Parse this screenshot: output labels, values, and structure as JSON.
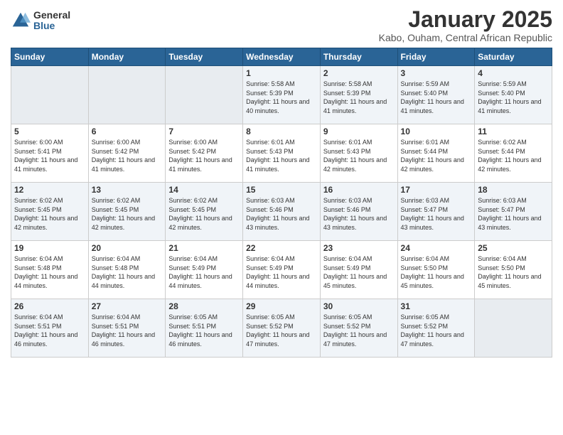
{
  "logo": {
    "general": "General",
    "blue": "Blue"
  },
  "title": "January 2025",
  "subtitle": "Kabo, Ouham, Central African Republic",
  "weekdays": [
    "Sunday",
    "Monday",
    "Tuesday",
    "Wednesday",
    "Thursday",
    "Friday",
    "Saturday"
  ],
  "weeks": [
    [
      {
        "day": "",
        "sunrise": "",
        "sunset": "",
        "daylight": ""
      },
      {
        "day": "",
        "sunrise": "",
        "sunset": "",
        "daylight": ""
      },
      {
        "day": "",
        "sunrise": "",
        "sunset": "",
        "daylight": ""
      },
      {
        "day": "1",
        "sunrise": "Sunrise: 5:58 AM",
        "sunset": "Sunset: 5:39 PM",
        "daylight": "Daylight: 11 hours and 40 minutes."
      },
      {
        "day": "2",
        "sunrise": "Sunrise: 5:58 AM",
        "sunset": "Sunset: 5:39 PM",
        "daylight": "Daylight: 11 hours and 41 minutes."
      },
      {
        "day": "3",
        "sunrise": "Sunrise: 5:59 AM",
        "sunset": "Sunset: 5:40 PM",
        "daylight": "Daylight: 11 hours and 41 minutes."
      },
      {
        "day": "4",
        "sunrise": "Sunrise: 5:59 AM",
        "sunset": "Sunset: 5:40 PM",
        "daylight": "Daylight: 11 hours and 41 minutes."
      }
    ],
    [
      {
        "day": "5",
        "sunrise": "Sunrise: 6:00 AM",
        "sunset": "Sunset: 5:41 PM",
        "daylight": "Daylight: 11 hours and 41 minutes."
      },
      {
        "day": "6",
        "sunrise": "Sunrise: 6:00 AM",
        "sunset": "Sunset: 5:42 PM",
        "daylight": "Daylight: 11 hours and 41 minutes."
      },
      {
        "day": "7",
        "sunrise": "Sunrise: 6:00 AM",
        "sunset": "Sunset: 5:42 PM",
        "daylight": "Daylight: 11 hours and 41 minutes."
      },
      {
        "day": "8",
        "sunrise": "Sunrise: 6:01 AM",
        "sunset": "Sunset: 5:43 PM",
        "daylight": "Daylight: 11 hours and 41 minutes."
      },
      {
        "day": "9",
        "sunrise": "Sunrise: 6:01 AM",
        "sunset": "Sunset: 5:43 PM",
        "daylight": "Daylight: 11 hours and 42 minutes."
      },
      {
        "day": "10",
        "sunrise": "Sunrise: 6:01 AM",
        "sunset": "Sunset: 5:44 PM",
        "daylight": "Daylight: 11 hours and 42 minutes."
      },
      {
        "day": "11",
        "sunrise": "Sunrise: 6:02 AM",
        "sunset": "Sunset: 5:44 PM",
        "daylight": "Daylight: 11 hours and 42 minutes."
      }
    ],
    [
      {
        "day": "12",
        "sunrise": "Sunrise: 6:02 AM",
        "sunset": "Sunset: 5:45 PM",
        "daylight": "Daylight: 11 hours and 42 minutes."
      },
      {
        "day": "13",
        "sunrise": "Sunrise: 6:02 AM",
        "sunset": "Sunset: 5:45 PM",
        "daylight": "Daylight: 11 hours and 42 minutes."
      },
      {
        "day": "14",
        "sunrise": "Sunrise: 6:02 AM",
        "sunset": "Sunset: 5:45 PM",
        "daylight": "Daylight: 11 hours and 42 minutes."
      },
      {
        "day": "15",
        "sunrise": "Sunrise: 6:03 AM",
        "sunset": "Sunset: 5:46 PM",
        "daylight": "Daylight: 11 hours and 43 minutes."
      },
      {
        "day": "16",
        "sunrise": "Sunrise: 6:03 AM",
        "sunset": "Sunset: 5:46 PM",
        "daylight": "Daylight: 11 hours and 43 minutes."
      },
      {
        "day": "17",
        "sunrise": "Sunrise: 6:03 AM",
        "sunset": "Sunset: 5:47 PM",
        "daylight": "Daylight: 11 hours and 43 minutes."
      },
      {
        "day": "18",
        "sunrise": "Sunrise: 6:03 AM",
        "sunset": "Sunset: 5:47 PM",
        "daylight": "Daylight: 11 hours and 43 minutes."
      }
    ],
    [
      {
        "day": "19",
        "sunrise": "Sunrise: 6:04 AM",
        "sunset": "Sunset: 5:48 PM",
        "daylight": "Daylight: 11 hours and 44 minutes."
      },
      {
        "day": "20",
        "sunrise": "Sunrise: 6:04 AM",
        "sunset": "Sunset: 5:48 PM",
        "daylight": "Daylight: 11 hours and 44 minutes."
      },
      {
        "day": "21",
        "sunrise": "Sunrise: 6:04 AM",
        "sunset": "Sunset: 5:49 PM",
        "daylight": "Daylight: 11 hours and 44 minutes."
      },
      {
        "day": "22",
        "sunrise": "Sunrise: 6:04 AM",
        "sunset": "Sunset: 5:49 PM",
        "daylight": "Daylight: 11 hours and 44 minutes."
      },
      {
        "day": "23",
        "sunrise": "Sunrise: 6:04 AM",
        "sunset": "Sunset: 5:49 PM",
        "daylight": "Daylight: 11 hours and 45 minutes."
      },
      {
        "day": "24",
        "sunrise": "Sunrise: 6:04 AM",
        "sunset": "Sunset: 5:50 PM",
        "daylight": "Daylight: 11 hours and 45 minutes."
      },
      {
        "day": "25",
        "sunrise": "Sunrise: 6:04 AM",
        "sunset": "Sunset: 5:50 PM",
        "daylight": "Daylight: 11 hours and 45 minutes."
      }
    ],
    [
      {
        "day": "26",
        "sunrise": "Sunrise: 6:04 AM",
        "sunset": "Sunset: 5:51 PM",
        "daylight": "Daylight: 11 hours and 46 minutes."
      },
      {
        "day": "27",
        "sunrise": "Sunrise: 6:04 AM",
        "sunset": "Sunset: 5:51 PM",
        "daylight": "Daylight: 11 hours and 46 minutes."
      },
      {
        "day": "28",
        "sunrise": "Sunrise: 6:05 AM",
        "sunset": "Sunset: 5:51 PM",
        "daylight": "Daylight: 11 hours and 46 minutes."
      },
      {
        "day": "29",
        "sunrise": "Sunrise: 6:05 AM",
        "sunset": "Sunset: 5:52 PM",
        "daylight": "Daylight: 11 hours and 47 minutes."
      },
      {
        "day": "30",
        "sunrise": "Sunrise: 6:05 AM",
        "sunset": "Sunset: 5:52 PM",
        "daylight": "Daylight: 11 hours and 47 minutes."
      },
      {
        "day": "31",
        "sunrise": "Sunrise: 6:05 AM",
        "sunset": "Sunset: 5:52 PM",
        "daylight": "Daylight: 11 hours and 47 minutes."
      },
      {
        "day": "",
        "sunrise": "",
        "sunset": "",
        "daylight": ""
      }
    ]
  ]
}
